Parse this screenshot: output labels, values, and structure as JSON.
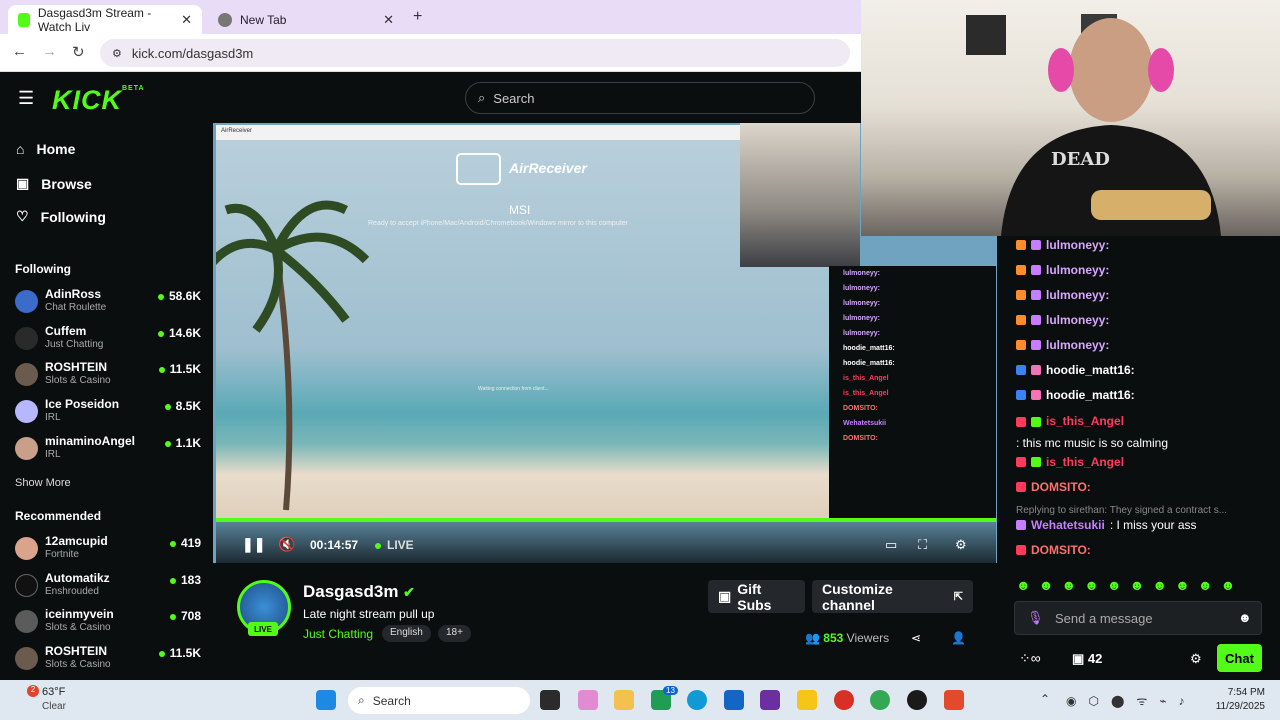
{
  "browser": {
    "tabs": [
      {
        "label": "Dasgasd3m Stream - Watch Liv"
      },
      {
        "label": "New Tab"
      }
    ],
    "url": "kick.com/dasgasd3m"
  },
  "header": {
    "logo": "KICK",
    "logo_badge": "BETA",
    "search_placeholder": "Search"
  },
  "sidebar": {
    "nav": [
      {
        "label": "Home",
        "icon": "home-icon"
      },
      {
        "label": "Browse",
        "icon": "browse-icon"
      },
      {
        "label": "Following",
        "icon": "heart-icon"
      }
    ],
    "following_title": "Following",
    "following": [
      {
        "name": "AdinRoss",
        "category": "Chat Roulette",
        "viewers": "58.6K"
      },
      {
        "name": "Cuffem",
        "category": "Just Chatting",
        "viewers": "14.6K"
      },
      {
        "name": "ROSHTEIN",
        "category": "Slots & Casino",
        "viewers": "11.5K"
      },
      {
        "name": "Ice Poseidon",
        "category": "IRL",
        "viewers": "8.5K"
      },
      {
        "name": "minaminoAngel",
        "category": "IRL",
        "viewers": "1.1K"
      }
    ],
    "show_more": "Show More",
    "recommended_title": "Recommended",
    "recommended": [
      {
        "name": "12amcupid",
        "category": "Fortnite",
        "viewers": "419"
      },
      {
        "name": "Automatikz",
        "category": "Enshrouded",
        "viewers": "183"
      },
      {
        "name": "iceinmyvein",
        "category": "Slots & Casino",
        "viewers": "708"
      },
      {
        "name": "ROSHTEIN",
        "category": "Slots & Casino",
        "viewers": "11.5K"
      }
    ]
  },
  "player": {
    "air_bar": "AirReceiver",
    "air_title": "AirReceiver",
    "device": "MSI",
    "ready_text": "Ready to accept iPhone/Mac/Android/Chromebook/Windows mirror to this computer",
    "waiting_text": "Waiting connection from client...",
    "time": "00:14:57",
    "live": "LIVE"
  },
  "stream": {
    "name": "Dasgasd3m",
    "title": "Late night stream pull up",
    "category": "Just Chatting",
    "tags": [
      "English",
      "18+"
    ],
    "live_badge": "LIVE",
    "viewers": "853",
    "viewers_label": "Viewers",
    "gift_subs": "Gift Subs",
    "customize": "Customize channel"
  },
  "chat": {
    "messages": [
      {
        "user": "lulmoneyy:",
        "text": "",
        "color": "#d7a6ff"
      },
      {
        "user": "lulmoneyy:",
        "text": "",
        "color": "#d7a6ff"
      },
      {
        "user": "lulmoneyy:",
        "text": "",
        "color": "#d7a6ff"
      },
      {
        "user": "lulmoneyy:",
        "text": "",
        "color": "#d7a6ff"
      },
      {
        "user": "lulmoneyy:",
        "text": "",
        "color": "#d7a6ff"
      },
      {
        "user": "hoodie_matt16:",
        "text": "",
        "color": "#ffffff"
      },
      {
        "user": "hoodie_matt16:",
        "text": "",
        "color": "#ffffff"
      },
      {
        "user": "is_this_Angel",
        "text": ": this mc music is so calming",
        "color": "#ff3b5c"
      },
      {
        "user": "is_this_Angel",
        "text": ":",
        "color": "#ff3b5c"
      },
      {
        "user": "DOMSITO:",
        "text": "",
        "color": "#ff6f6f"
      }
    ],
    "reply_line": "Replying to sirethan: They signed a contract s...",
    "reply_msg": {
      "user": "Wehatetsukii",
      "text": ": I miss your ass",
      "color": "#c77dff"
    },
    "last_msg": {
      "user": "DOMSITO:",
      "text": "",
      "color": "#ff6f6f"
    },
    "input_placeholder": "Send a message",
    "count": "42",
    "chat_button": "Chat"
  },
  "taskbar": {
    "weather_temp": "63°F",
    "weather_desc": "Clear",
    "search": "Search",
    "time": "7:54 PM",
    "date": "11/29/2025",
    "notif": "2",
    "badge_13": "13"
  }
}
